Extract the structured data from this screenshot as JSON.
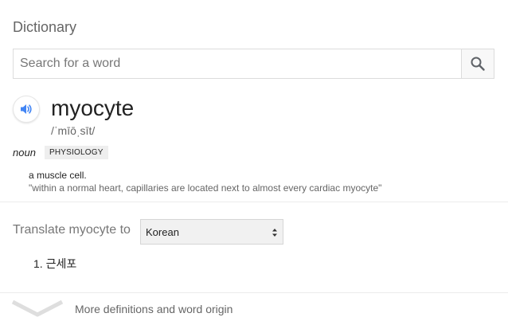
{
  "dictionary": {
    "title": "Dictionary",
    "search": {
      "placeholder": "Search for a word",
      "value": ""
    },
    "icons": {
      "search": "search-icon",
      "speaker": "speaker-icon",
      "expand": "chevron-down-icon",
      "select_arrows": "up-down-arrows-icon"
    },
    "entry": {
      "word": "myocyte",
      "phonetic": "/ˈmīōˌsīt/",
      "part_of_speech": "noun",
      "domain_tag": "PHYSIOLOGY",
      "definition": "a muscle cell.",
      "example": "\"within a normal heart, capillaries are located next to almost every cardiac myocyte\""
    },
    "translate": {
      "label": "Translate myocyte to",
      "selected_language": "Korean",
      "results": [
        {
          "number": "1.",
          "text": "근세포"
        }
      ]
    },
    "more": {
      "label": "More definitions and word origin"
    },
    "colors": {
      "accent_blue": "#4285f4",
      "divider": "#ebebeb",
      "muted_text": "#666666"
    }
  }
}
